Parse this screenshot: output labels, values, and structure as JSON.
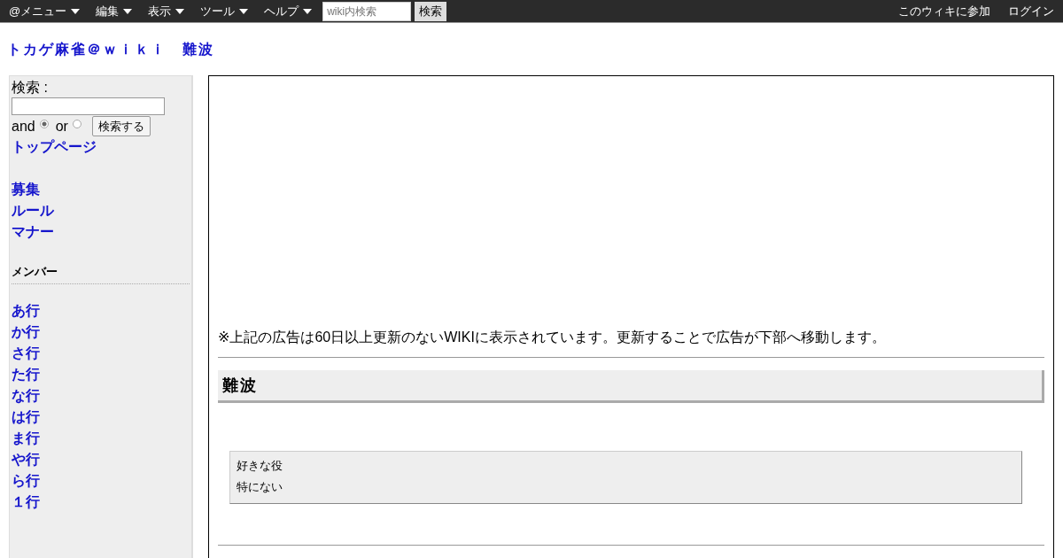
{
  "menubar": {
    "menus": [
      "@メニュー",
      "編集",
      "表示",
      "ツール",
      "ヘルプ"
    ],
    "search": {
      "placeholder": "wiki内検索",
      "button": "検索"
    },
    "right_links": [
      "このウィキに参加",
      "ログイン"
    ]
  },
  "site_title": "トカゲ麻雀＠ｗｉｋｉ　難波",
  "sidebar": {
    "search_label": "検索 :",
    "modes": [
      {
        "label": "and",
        "selected": true
      },
      {
        "label": "or",
        "selected": false
      }
    ],
    "search_button": "検索する",
    "top_link": "トップページ",
    "links": [
      "募集",
      "ルール",
      "マナー"
    ],
    "members_heading": "メンバー",
    "member_links": [
      "あ行",
      "か行",
      "さ行",
      "た行",
      "な行",
      "は行",
      "ま行",
      "や行",
      "ら行",
      "１行"
    ]
  },
  "main": {
    "ad_note": "※上記の広告は60日以上更新のないWIKIに表示されています。更新することで広告が下部へ移動します。",
    "heading": "難波",
    "box_lines": [
      "好きな役",
      "特にない"
    ]
  }
}
